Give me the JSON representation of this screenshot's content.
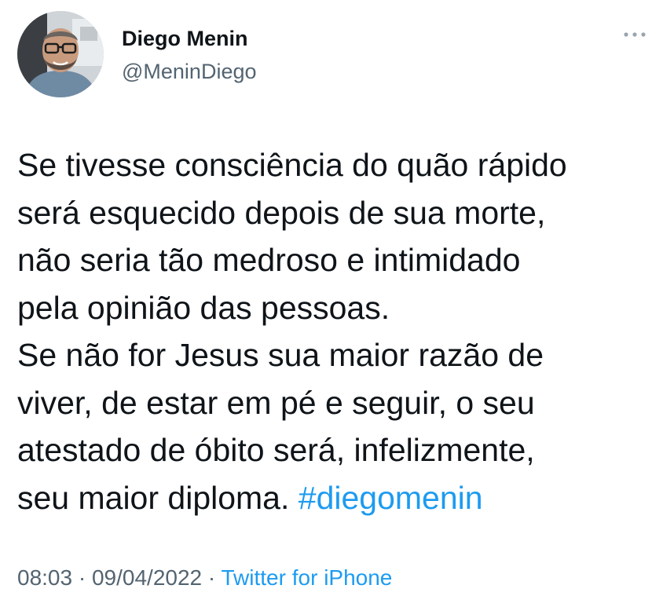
{
  "author": {
    "name": "Diego Menin",
    "handle": "@MeninDiego"
  },
  "tweet": {
    "text_body": "Se tivesse consciência do quão rápido\nserá esquecido depois de sua morte,\nnão seria tão medroso e intimidado\npela opinião das pessoas.\nSe não for Jesus sua maior razão de\nviver, de estar em pé e seguir, o seu\natestado de óbito será, infelizmente,\nseu maior diploma. ",
    "hashtag": "#diegomenin"
  },
  "meta": {
    "time": "08:03",
    "separator": " · ",
    "date": "09/04/2022",
    "source": "Twitter for iPhone"
  },
  "colors": {
    "link": "#1d9bf0",
    "secondary_text": "#536471",
    "primary_text": "#0f1419"
  },
  "icons": {
    "more": "more-dots-icon"
  }
}
